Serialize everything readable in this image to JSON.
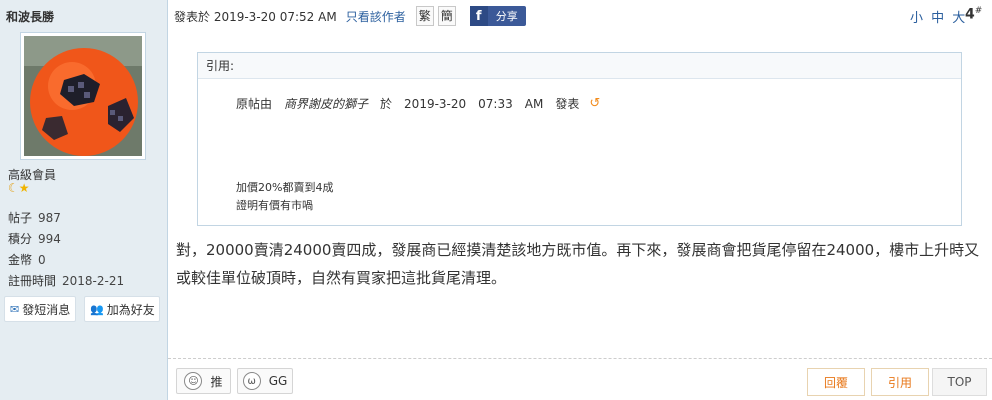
{
  "sidebar": {
    "username": "和波長勝",
    "rank": "高級會員",
    "stats": [
      {
        "label": "帖子",
        "value": "987"
      },
      {
        "label": "積分",
        "value": "994"
      },
      {
        "label": "金幣",
        "value": "0"
      },
      {
        "label": "註冊時間",
        "value": "2018-2-21"
      }
    ],
    "buttons": {
      "message": "發短消息",
      "friend": "加為好友"
    }
  },
  "post": {
    "posted_at": "發表於 2019-3-20 07:52 AM",
    "author_only": "只看該作者",
    "traditional": "繁",
    "simplified": "簡",
    "share": "分享",
    "font_size": "小 中 大",
    "floor": "4",
    "floor_mark": "#",
    "quote": {
      "header": "引用:",
      "original_prefix": "原帖由",
      "original_author": "商界謝皮的獅子",
      "at": "於",
      "date": "2019-3-20",
      "time": "07:33",
      "ampm": "AM",
      "posted": "發表",
      "lines": [
        "加價20%都賣到4成",
        "證明有價有市喎"
      ]
    },
    "content": "對，20000賣清24000賣四成，發展商已經摸清楚該地方既市值。再下來，發展商會把貨尾停留在24000，樓市上升時又或較佳單位破頂時，自然有買家把這批貨尾清理。"
  },
  "actions": {
    "recommend": "推",
    "gg": "GG",
    "reply": "回覆",
    "quote": "引用",
    "top": "TOP"
  },
  "colors": {
    "sidebar_bg": "#e5edf2",
    "link": "#2b5f9e",
    "facebook": "#3b5998",
    "accent_orange": "#e8781a"
  }
}
